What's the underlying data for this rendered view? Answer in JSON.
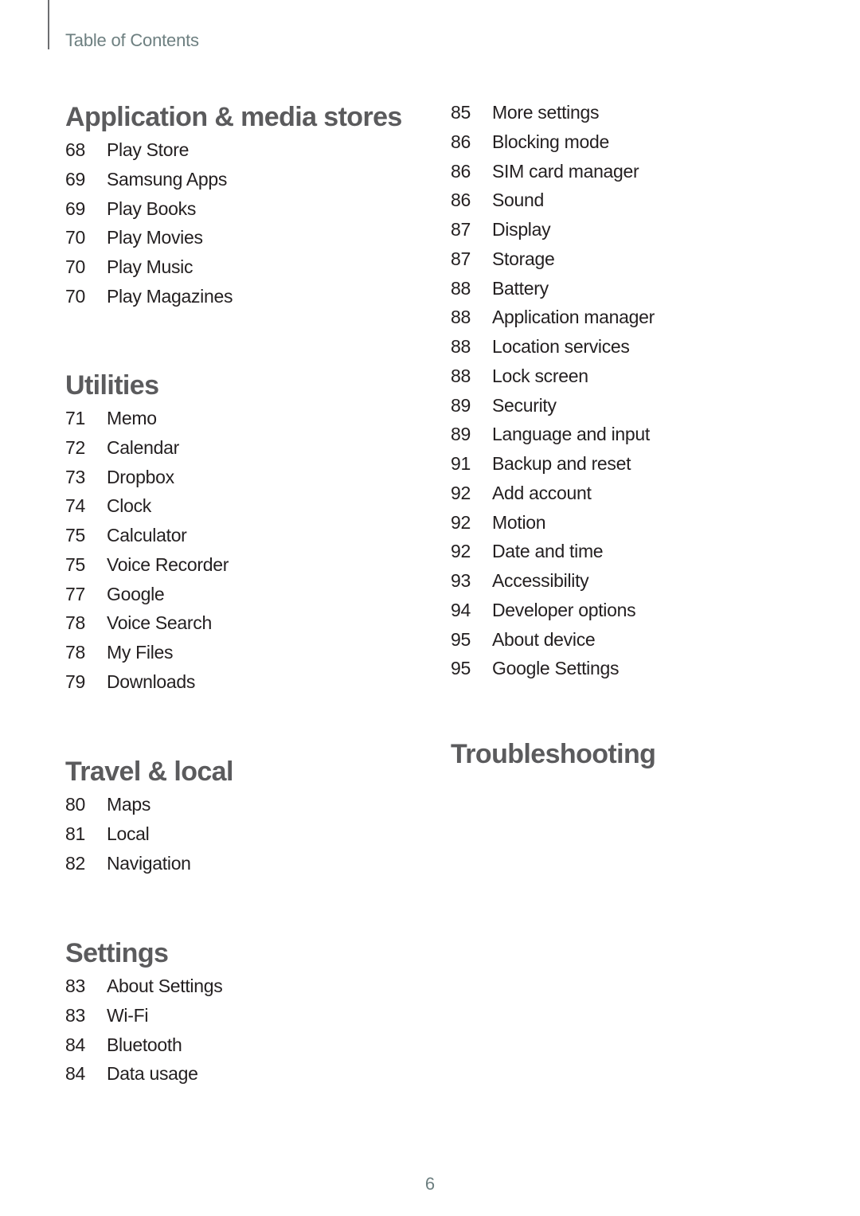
{
  "header": {
    "title": "Table of Contents"
  },
  "left_column": {
    "sections": [
      {
        "title": "Application & media stores",
        "entries": [
          {
            "page": "68",
            "label": "Play Store"
          },
          {
            "page": "69",
            "label": "Samsung Apps"
          },
          {
            "page": "69",
            "label": "Play Books"
          },
          {
            "page": "70",
            "label": "Play Movies"
          },
          {
            "page": "70",
            "label": "Play Music"
          },
          {
            "page": "70",
            "label": "Play Magazines"
          }
        ]
      },
      {
        "title": "Utilities",
        "entries": [
          {
            "page": "71",
            "label": "Memo"
          },
          {
            "page": "72",
            "label": "Calendar"
          },
          {
            "page": "73",
            "label": "Dropbox"
          },
          {
            "page": "74",
            "label": "Clock"
          },
          {
            "page": "75",
            "label": "Calculator"
          },
          {
            "page": "75",
            "label": "Voice Recorder"
          },
          {
            "page": "77",
            "label": "Google"
          },
          {
            "page": "78",
            "label": "Voice Search"
          },
          {
            "page": "78",
            "label": "My Files"
          },
          {
            "page": "79",
            "label": "Downloads"
          }
        ]
      },
      {
        "title": "Travel & local",
        "entries": [
          {
            "page": "80",
            "label": "Maps"
          },
          {
            "page": "81",
            "label": "Local"
          },
          {
            "page": "82",
            "label": "Navigation"
          }
        ]
      },
      {
        "title": "Settings",
        "entries": [
          {
            "page": "83",
            "label": "About Settings"
          },
          {
            "page": "83",
            "label": "Wi-Fi"
          },
          {
            "page": "84",
            "label": "Bluetooth"
          },
          {
            "page": "84",
            "label": "Data usage"
          }
        ]
      }
    ]
  },
  "right_column": {
    "continued_entries": [
      {
        "page": "85",
        "label": "More settings"
      },
      {
        "page": "86",
        "label": "Blocking mode"
      },
      {
        "page": "86",
        "label": "SIM card manager"
      },
      {
        "page": "86",
        "label": "Sound"
      },
      {
        "page": "87",
        "label": "Display"
      },
      {
        "page": "87",
        "label": "Storage"
      },
      {
        "page": "88",
        "label": "Battery"
      },
      {
        "page": "88",
        "label": "Application manager"
      },
      {
        "page": "88",
        "label": "Location services"
      },
      {
        "page": "88",
        "label": "Lock screen"
      },
      {
        "page": "89",
        "label": "Security"
      },
      {
        "page": "89",
        "label": "Language and input"
      },
      {
        "page": "91",
        "label": "Backup and reset"
      },
      {
        "page": "92",
        "label": "Add account"
      },
      {
        "page": "92",
        "label": "Motion"
      },
      {
        "page": "92",
        "label": "Date and time"
      },
      {
        "page": "93",
        "label": "Accessibility"
      },
      {
        "page": "94",
        "label": "Developer options"
      },
      {
        "page": "95",
        "label": "About device"
      },
      {
        "page": "95",
        "label": "Google Settings"
      }
    ],
    "sections": [
      {
        "title": "Troubleshooting",
        "entries": []
      }
    ]
  },
  "footer": {
    "page_number": "6"
  }
}
